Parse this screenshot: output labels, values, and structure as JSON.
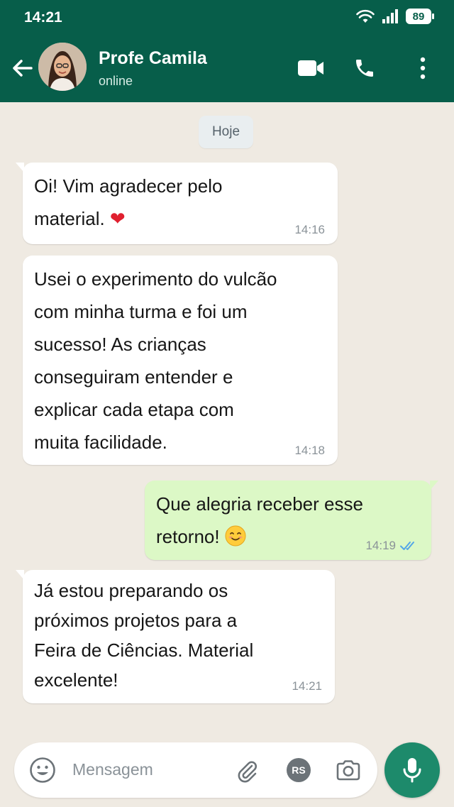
{
  "status_bar": {
    "time": "14:21",
    "battery": "89"
  },
  "header": {
    "contact_name": "Profe Camila",
    "contact_status": "online"
  },
  "day_separator": "Hoje",
  "messages": [
    {
      "direction": "incoming",
      "lines": [
        "Oi! Vim agradecer pelo",
        "material. "
      ],
      "emoji": "❤",
      "time": "14:16"
    },
    {
      "direction": "incoming",
      "lines": [
        "Usei o experimento do vulcão",
        "com minha turma e foi um",
        "sucesso! As crianças",
        "conseguiram entender e",
        "explicar cada etapa com",
        "muita facilidade."
      ],
      "time": "14:18"
    },
    {
      "direction": "outgoing",
      "lines": [
        "Que alegria receber esse",
        "retorno! "
      ],
      "emoji": "smiling-face",
      "time": "14:19",
      "read_receipt": "double-check-read"
    },
    {
      "direction": "incoming",
      "lines": [
        "Já estou preparando os",
        "próximos projetos para a",
        "Feira de Ciências. Material",
        "excelente!"
      ],
      "time": "14:21"
    }
  ],
  "composer": {
    "placeholder": "Mensagem",
    "avatar_initials": "RS"
  },
  "colors": {
    "header": "#075e4a",
    "incoming_bubble": "#ffffff",
    "outgoing_bubble": "#dcf8c6",
    "mic_button": "#1d8a6b",
    "read_tick": "#53a6e8",
    "chat_background": "#efeae2"
  }
}
